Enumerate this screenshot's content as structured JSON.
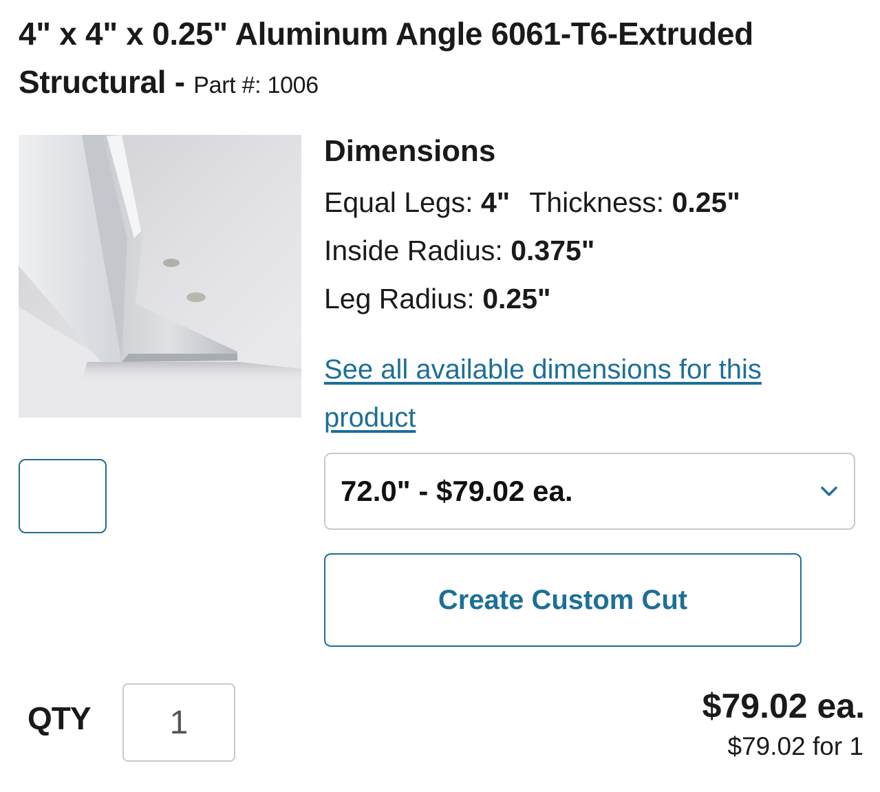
{
  "product": {
    "title": "4\" x 4\" x 0.25\" Aluminum Angle 6061-T6-Extruded Structural -",
    "part_label": "Part #:",
    "part_number": "1006"
  },
  "image": {
    "icon": "aluminum-angle-photo"
  },
  "dimensions": {
    "heading": "Dimensions",
    "equal_legs_label": "Equal Legs:",
    "equal_legs_value": "4\"",
    "thickness_label": "Thickness:",
    "thickness_value": "0.25\"",
    "inside_radius_label": "Inside Radius:",
    "inside_radius_value": "0.375\"",
    "leg_radius_label": "Leg Radius:",
    "leg_radius_value": "0.25\"",
    "see_all_link": "See all available dimensions for this product"
  },
  "length_select": {
    "selected": "72.0\" - $79.02 ea.",
    "icon": "chevron-down-icon"
  },
  "custom_cut_button": "Create Custom Cut",
  "quantity": {
    "label": "QTY",
    "value": "1"
  },
  "pricing": {
    "unit_price": "$79.02 ea.",
    "total": "$79.02 for 1"
  },
  "colors": {
    "accent": "#1d6f97",
    "text": "#1a1a1a",
    "border": "#c9c9c9"
  }
}
